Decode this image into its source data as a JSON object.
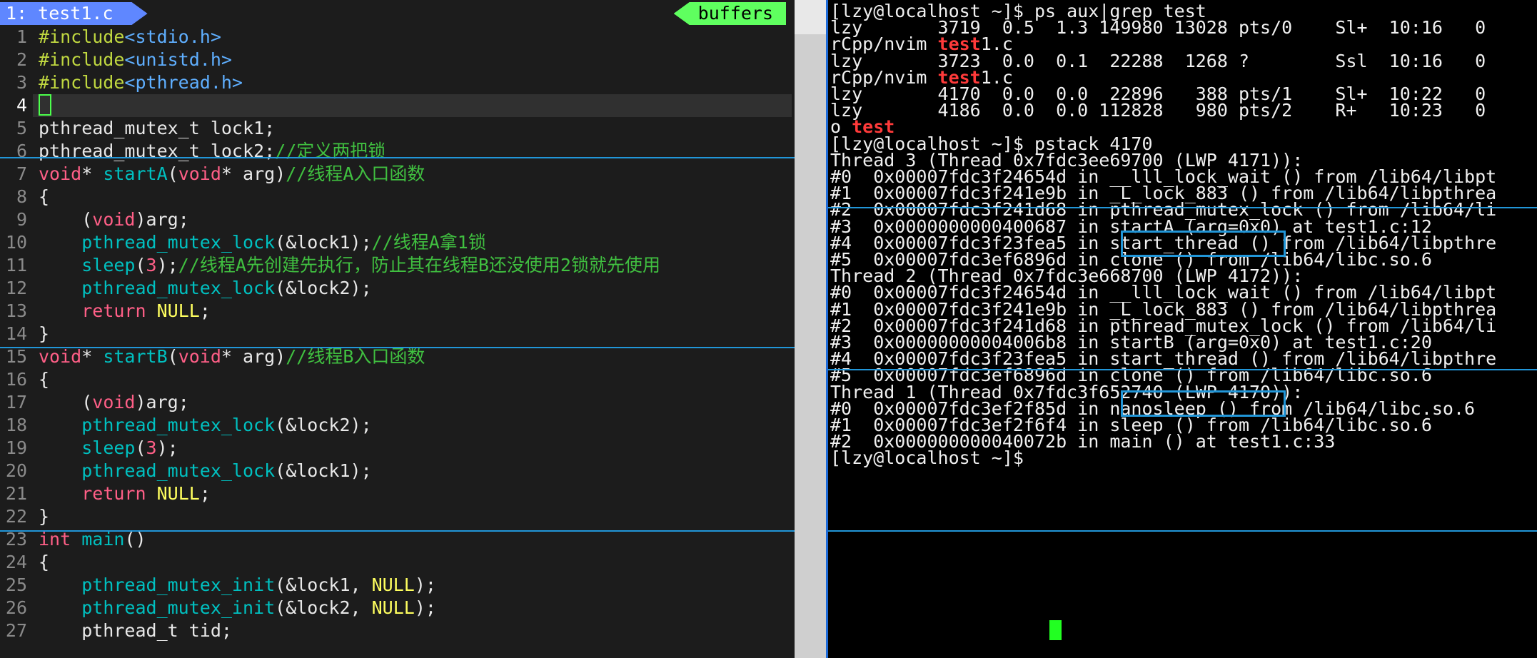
{
  "editor": {
    "tab_label": "1: test1.c",
    "buffers_label": "buffers",
    "lines": [
      {
        "n": "1",
        "parts": [
          [
            "pre",
            "#include"
          ],
          [
            "inc",
            "<stdio.h>"
          ]
        ]
      },
      {
        "n": "2",
        "parts": [
          [
            "pre",
            "#include"
          ],
          [
            "inc",
            "<unistd.h>"
          ]
        ]
      },
      {
        "n": "3",
        "parts": [
          [
            "pre",
            "#include"
          ],
          [
            "inc",
            "<pthread.h>"
          ]
        ]
      },
      {
        "n": "4",
        "parts": [],
        "cursor": true
      },
      {
        "n": "5",
        "parts": [
          [
            "norm",
            "pthread_mutex_t lock1;"
          ]
        ]
      },
      {
        "n": "6",
        "parts": [
          [
            "norm",
            "pthread_mutex_t lock2;"
          ],
          [
            "cmt",
            "//定义两把锁"
          ]
        ]
      },
      {
        "n": "7",
        "parts": [
          [
            "type",
            "void"
          ],
          [
            "norm",
            "* "
          ],
          [
            "func",
            "startA"
          ],
          [
            "norm",
            "("
          ],
          [
            "type",
            "void"
          ],
          [
            "norm",
            "* arg)"
          ],
          [
            "cmt",
            "//线程A入口函数"
          ]
        ]
      },
      {
        "n": "8",
        "parts": [
          [
            "norm",
            "{"
          ]
        ]
      },
      {
        "n": "9",
        "parts": [
          [
            "norm",
            "    ("
          ],
          [
            "type",
            "void"
          ],
          [
            "norm",
            ")arg;"
          ]
        ]
      },
      {
        "n": "10",
        "parts": [
          [
            "norm",
            "    "
          ],
          [
            "func",
            "pthread_mutex_lock"
          ],
          [
            "norm",
            "(&lock1);"
          ],
          [
            "cmt",
            "//线程A拿1锁"
          ]
        ]
      },
      {
        "n": "11",
        "parts": [
          [
            "norm",
            "    "
          ],
          [
            "func",
            "sleep"
          ],
          [
            "norm",
            "("
          ],
          [
            "num",
            "3"
          ],
          [
            "norm",
            ");"
          ],
          [
            "cmt",
            "//线程A先创建先执行，防止其在线程B还没使用2锁就先使用"
          ]
        ]
      },
      {
        "n": "12",
        "parts": [
          [
            "norm",
            "    "
          ],
          [
            "func",
            "pthread_mutex_lock"
          ],
          [
            "norm",
            "(&lock2);"
          ]
        ]
      },
      {
        "n": "13",
        "parts": [
          [
            "norm",
            "    "
          ],
          [
            "ret",
            "return"
          ],
          [
            "norm",
            " "
          ],
          [
            "null",
            "NULL"
          ],
          [
            "norm",
            ";"
          ]
        ]
      },
      {
        "n": "14",
        "parts": [
          [
            "norm",
            "}"
          ]
        ]
      },
      {
        "n": "15",
        "parts": [
          [
            "type",
            "void"
          ],
          [
            "norm",
            "* "
          ],
          [
            "func",
            "startB"
          ],
          [
            "norm",
            "("
          ],
          [
            "type",
            "void"
          ],
          [
            "norm",
            "* arg)"
          ],
          [
            "cmt",
            "//线程B入口函数"
          ]
        ]
      },
      {
        "n": "16",
        "parts": [
          [
            "norm",
            "{"
          ]
        ]
      },
      {
        "n": "17",
        "parts": [
          [
            "norm",
            "    ("
          ],
          [
            "type",
            "void"
          ],
          [
            "norm",
            ")arg;"
          ]
        ]
      },
      {
        "n": "18",
        "parts": [
          [
            "norm",
            "    "
          ],
          [
            "func",
            "pthread_mutex_lock"
          ],
          [
            "norm",
            "(&lock2);"
          ]
        ]
      },
      {
        "n": "19",
        "parts": [
          [
            "norm",
            "    "
          ],
          [
            "func",
            "sleep"
          ],
          [
            "norm",
            "("
          ],
          [
            "num",
            "3"
          ],
          [
            "norm",
            ");"
          ]
        ]
      },
      {
        "n": "20",
        "parts": [
          [
            "norm",
            "    "
          ],
          [
            "func",
            "pthread_mutex_lock"
          ],
          [
            "norm",
            "(&lock1);"
          ]
        ]
      },
      {
        "n": "21",
        "parts": [
          [
            "norm",
            "    "
          ],
          [
            "ret",
            "return"
          ],
          [
            "norm",
            " "
          ],
          [
            "null",
            "NULL"
          ],
          [
            "norm",
            ";"
          ]
        ]
      },
      {
        "n": "22",
        "parts": [
          [
            "norm",
            "}"
          ]
        ]
      },
      {
        "n": "23",
        "parts": [
          [
            "type",
            "int"
          ],
          [
            "norm",
            " "
          ],
          [
            "func",
            "main"
          ],
          [
            "norm",
            "()"
          ]
        ]
      },
      {
        "n": "24",
        "parts": [
          [
            "norm",
            "{"
          ]
        ]
      },
      {
        "n": "25",
        "parts": [
          [
            "norm",
            "    "
          ],
          [
            "func",
            "pthread_mutex_init"
          ],
          [
            "norm",
            "(&lock1, "
          ],
          [
            "null",
            "NULL"
          ],
          [
            "norm",
            ");"
          ]
        ]
      },
      {
        "n": "26",
        "parts": [
          [
            "norm",
            "    "
          ],
          [
            "func",
            "pthread_mutex_init"
          ],
          [
            "norm",
            "(&lock2, "
          ],
          [
            "null",
            "NULL"
          ],
          [
            "norm",
            ");"
          ]
        ]
      },
      {
        "n": "27",
        "parts": [
          [
            "norm",
            "    pthread_t tid;"
          ]
        ]
      }
    ]
  },
  "terminal": {
    "lines": [
      [
        [
          "n",
          "[lzy@localhost ~]$ ps aux|grep test"
        ]
      ],
      [
        [
          "n",
          "lzy       3719  0.5  1.3 149980 13028 pts/0    Sl+  10:16   0"
        ]
      ],
      [
        [
          "n",
          "rCpp/nvim "
        ],
        [
          "r",
          "test"
        ],
        [
          "n",
          "1.c"
        ]
      ],
      [
        [
          "n",
          "lzy       3723  0.0  0.1  22288  1268 ?        Ssl  10:16   0"
        ]
      ],
      [
        [
          "n",
          "rCpp/nvim "
        ],
        [
          "r",
          "test"
        ],
        [
          "n",
          "1.c"
        ]
      ],
      [
        [
          "n",
          "lzy       4170  0.0  0.0  22896   388 pts/1    Sl+  10:22   0"
        ]
      ],
      [
        [
          "n",
          "lzy       4186  0.0  0.0 112828   980 pts/2    R+   10:23   0"
        ]
      ],
      [
        [
          "n",
          "o "
        ],
        [
          "r",
          "test"
        ]
      ],
      [
        [
          "n",
          "[lzy@localhost ~]$ pstack 4170"
        ]
      ],
      [
        [
          "n",
          "Thread 3 (Thread 0x7fdc3ee69700 (LWP 4171)):"
        ]
      ],
      [
        [
          "n",
          "#0  0x00007fdc3f24654d in __lll_lock_wait () from /lib64/libpt"
        ]
      ],
      [
        [
          "n",
          "#1  0x00007fdc3f241e9b in _L_lock_883 () from /lib64/libpthrea"
        ]
      ],
      [
        [
          "n",
          "#2  0x00007fdc3f241d68 in pthread_mutex_lock () from /lib64/li"
        ]
      ],
      [
        [
          "n",
          "#3  0x0000000000400687 in startA (arg=0x0) at test1.c:12"
        ]
      ],
      [
        [
          "n",
          "#4  0x00007fdc3f23fea5 in start_thread () from /lib64/libpthre"
        ]
      ],
      [
        [
          "n",
          "#5  0x00007fdc3ef6896d in clone () from /lib64/libc.so.6"
        ]
      ],
      [
        [
          "n",
          "Thread 2 (Thread 0x7fdc3e668700 (LWP 4172)):"
        ]
      ],
      [
        [
          "n",
          "#0  0x00007fdc3f24654d in __lll_lock_wait () from /lib64/libpt"
        ]
      ],
      [
        [
          "n",
          "#1  0x00007fdc3f241e9b in _L_lock_883 () from /lib64/libpthrea"
        ]
      ],
      [
        [
          "n",
          "#2  0x00007fdc3f241d68 in pthread_mutex_lock () from /lib64/li"
        ]
      ],
      [
        [
          "n",
          "#3  0x00000000004006b8 in startB (arg=0x0) at test1.c:20"
        ]
      ],
      [
        [
          "n",
          "#4  0x00007fdc3f23fea5 in start_thread () from /lib64/libpthre"
        ]
      ],
      [
        [
          "n",
          "#5  0x00007fdc3ef6896d in clone () from /lib64/libc.so.6"
        ]
      ],
      [
        [
          "n",
          "Thread 1 (Thread 0x7fdc3f652740 (LWP 4170)):"
        ]
      ],
      [
        [
          "n",
          "#0  0x00007fdc3ef2f85d in nanosleep () from /lib64/libc.so.6"
        ]
      ],
      [
        [
          "n",
          "#1  0x00007fdc3ef2f6f4 in sleep () from /lib64/libc.so.6"
        ]
      ],
      [
        [
          "n",
          "#2  0x000000000040072b in main () at test1.c:33"
        ]
      ],
      [
        [
          "n",
          "[lzy@localhost ~]$ "
        ]
      ]
    ]
  },
  "colors": {
    "tab_active": "#5f87ff",
    "tab_buffers": "#5fff5f",
    "annotation": "#2196d8",
    "terminal_cursor": "#22ff22"
  }
}
